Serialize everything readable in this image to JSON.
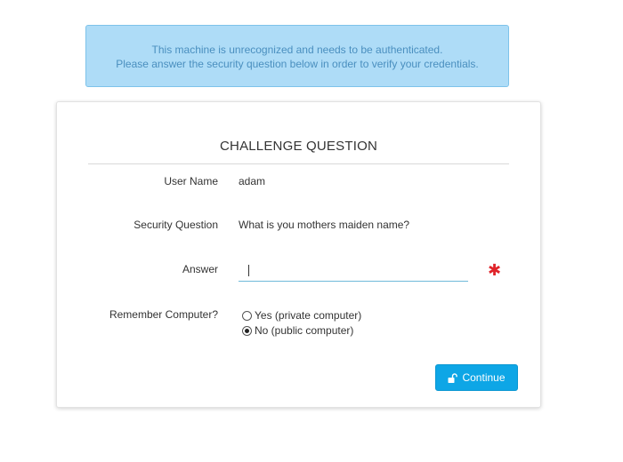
{
  "notice": {
    "line1": "This machine is unrecognized and needs to be authenticated.",
    "line2": "Please answer the security question below in order to verify your credentials."
  },
  "form": {
    "title": "CHALLENGE QUESTION",
    "username_label": "User Name",
    "username_value": "adam",
    "security_question_label": "Security Question",
    "security_question_value": "What is you mothers maiden name?",
    "answer_label": "Answer",
    "answer_value": "",
    "required_marker": "✱",
    "remember_label": "Remember Computer?",
    "remember_options": [
      {
        "label": "Yes (private computer)",
        "selected": false
      },
      {
        "label": "No (public computer)",
        "selected": true
      }
    ],
    "continue_label": "Continue",
    "continue_icon": "unlock-icon"
  },
  "colors": {
    "notice_bg": "#aedcf7",
    "notice_text": "#4a8fbf",
    "button_bg": "#0ea6e6",
    "required": "#e0242a",
    "input_underline": "#6fb9d9"
  }
}
